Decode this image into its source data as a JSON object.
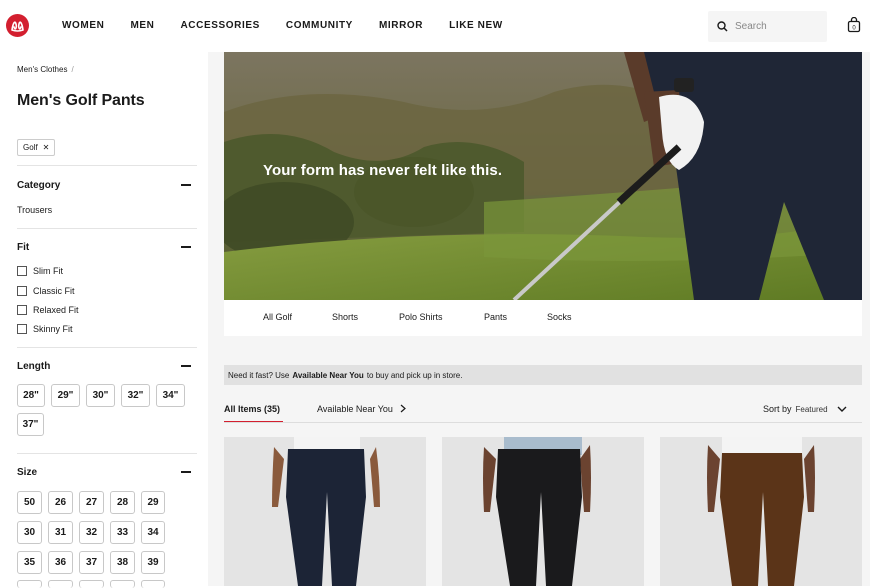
{
  "header": {
    "nav": [
      "WOMEN",
      "MEN",
      "ACCESSORIES",
      "COMMUNITY",
      "MIRROR",
      "LIKE NEW"
    ],
    "search_placeholder": "Search",
    "bag_count": "0",
    "brand_color": "#d31f2f"
  },
  "sidebar": {
    "breadcrumb": "Men's Clothes",
    "title": "Men's Golf Pants",
    "filter_chip": "Golf",
    "category": {
      "title": "Category",
      "items": [
        "Trousers"
      ]
    },
    "fit": {
      "title": "Fit",
      "items": [
        "Slim Fit",
        "Classic Fit",
        "Relaxed Fit",
        "Skinny Fit"
      ]
    },
    "length": {
      "title": "Length",
      "items": [
        "28\"",
        "29\"",
        "30\"",
        "32\"",
        "34\"",
        "37\""
      ]
    },
    "size": {
      "title": "Size",
      "items": [
        "50",
        "26",
        "27",
        "28",
        "29",
        "30",
        "31",
        "32",
        "33",
        "34",
        "35",
        "36",
        "37",
        "38",
        "39"
      ]
    }
  },
  "hero": {
    "headline": "Your form has never felt like this."
  },
  "subnav": [
    "All Golf",
    "Shorts",
    "Polo Shirts",
    "Pants",
    "Socks"
  ],
  "notice": {
    "prefix": "Need it fast? Use",
    "bold": "Available Near You",
    "suffix": "to buy and pick up in store."
  },
  "results": {
    "tab_all": "All Items (35)",
    "tab_near": "Available Near You",
    "sort_label": "Sort by",
    "sort_value": "Featured"
  },
  "products": [
    {
      "name": "navy pants",
      "pant_color": "#1c2436"
    },
    {
      "name": "black pants",
      "pant_color": "#1a1a1c"
    },
    {
      "name": "brown pants",
      "pant_color": "#5b3418"
    }
  ]
}
